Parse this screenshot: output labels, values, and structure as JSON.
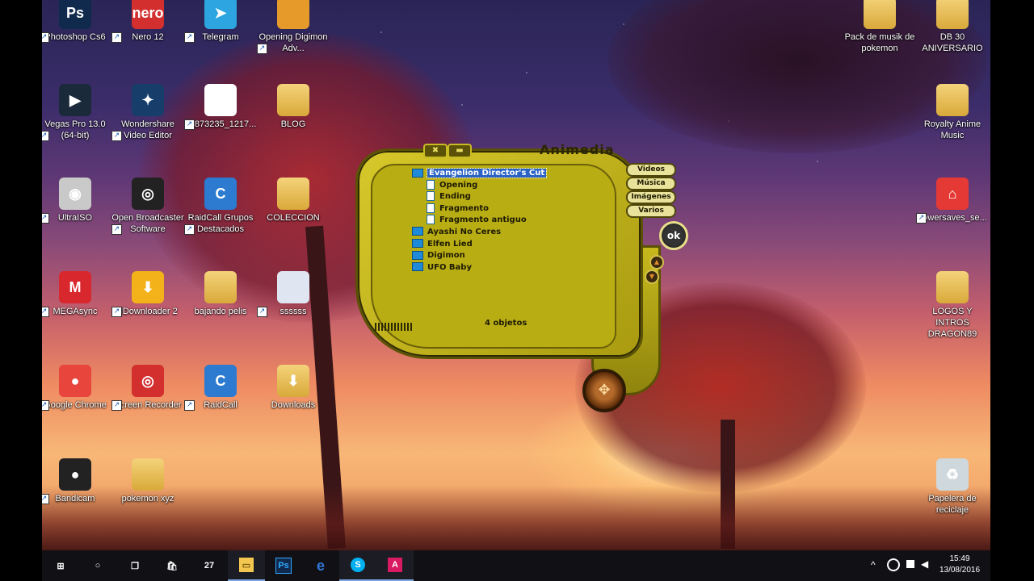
{
  "desktop": {
    "icons_left": [
      {
        "label": "Photoshop Cs6",
        "icon": "photoshop-icon",
        "glyph": "Ps",
        "color": "#0f2a4d"
      },
      {
        "label": "Nero 12",
        "icon": "nero-icon",
        "glyph": "nero",
        "color": "#d32f2f"
      },
      {
        "label": "Telegram",
        "icon": "telegram-icon",
        "glyph": "➤",
        "color": "#2ca5e0"
      },
      {
        "label": "Opening Digimon Adv...",
        "icon": "video-thumbnail-icon",
        "glyph": "",
        "color": "#e59a2a"
      },
      {
        "label": "Vegas Pro 13.0 (64-bit)",
        "icon": "vegas-icon",
        "glyph": "▶",
        "color": "#1a2a3a"
      },
      {
        "label": "Wondershare Video Editor",
        "icon": "wondershare-icon",
        "glyph": "✦",
        "color": "#173e6b"
      },
      {
        "label": "13873235_1217...",
        "icon": "image-file-icon",
        "glyph": "",
        "color": "#ffffff"
      },
      {
        "label": "BLOG",
        "icon": "folder-icon",
        "glyph": "",
        "color": "#e1b84c"
      },
      {
        "label": "UltraISO",
        "icon": "ultraiso-icon",
        "glyph": "◉",
        "color": "#c9c9c9"
      },
      {
        "label": "Open Broadcaster Software",
        "icon": "obs-icon",
        "glyph": "◎",
        "color": "#222"
      },
      {
        "label": "RaidCall Grupos Destacados",
        "icon": "raidcall-icon",
        "glyph": "C",
        "color": "#2c7bd1"
      },
      {
        "label": "COLECCION",
        "icon": "folder-icon",
        "glyph": "",
        "color": "#e1b84c"
      },
      {
        "label": "MEGAsync",
        "icon": "mega-icon",
        "glyph": "M",
        "color": "#d9272e"
      },
      {
        "label": "JDownloader 2",
        "icon": "jdownloader-icon",
        "glyph": "⬇",
        "color": "#f3b21a"
      },
      {
        "label": "bajando pelis",
        "icon": "folder-icon",
        "glyph": "",
        "color": "#e1b84c"
      },
      {
        "label": "ssssss",
        "icon": "document-icon",
        "glyph": "",
        "color": "#dfe6f2"
      },
      {
        "label": "Google Chrome",
        "icon": "chrome-icon",
        "glyph": "●",
        "color": "#e8453c"
      },
      {
        "label": "Screen Recorder",
        "icon": "screen-recorder-icon",
        "glyph": "◎",
        "color": "#d32f2f"
      },
      {
        "label": "RaidCall",
        "icon": "raidcall-icon",
        "glyph": "C",
        "color": "#2c7bd1"
      },
      {
        "label": "Downloads",
        "icon": "downloads-folder-icon",
        "glyph": "⬇",
        "color": "#e1b84c"
      },
      {
        "label": "Bandicam",
        "icon": "bandicam-icon",
        "glyph": "●",
        "color": "#222"
      },
      {
        "label": "pokemon xyz",
        "icon": "folder-icon",
        "glyph": "",
        "color": "#e1b84c"
      }
    ],
    "icons_right": [
      {
        "label": "Pack de musik de pokemon",
        "icon": "folder-icon",
        "glyph": "",
        "color": "#e1b84c"
      },
      {
        "label": "DB 30 ANIVERSARIO",
        "icon": "folder-icon",
        "glyph": "",
        "color": "#e1b84c"
      },
      {
        "label": "Royalty Anime Music",
        "icon": "folder-icon",
        "glyph": "",
        "color": "#e1b84c"
      },
      {
        "label": "powersaves_se...",
        "icon": "powersaves-icon",
        "glyph": "⌂",
        "color": "#e53935"
      },
      {
        "label": "LOGOS Y INTROS DRAGON89",
        "icon": "folder-icon",
        "glyph": "",
        "color": "#e1b84c"
      },
      {
        "label": "Papelera de reciclaje",
        "icon": "recycle-bin-icon",
        "glyph": "♻",
        "color": "#cfd8dc"
      }
    ]
  },
  "player": {
    "title": "Animedia",
    "close_glyph": "✖",
    "minimize_glyph": "▬",
    "categories": [
      "Videos",
      "Música",
      "Imágenes",
      "Varios"
    ],
    "ok_label": "ok",
    "tree": [
      {
        "label": "Evangelion Director's Cut",
        "selected": true,
        "children": [
          "Opening",
          "Ending",
          "Fragmento",
          "Fragmento antiguo"
        ]
      },
      {
        "label": "Ayashi No Ceres"
      },
      {
        "label": "Elfen Lied"
      },
      {
        "label": "Digimon"
      },
      {
        "label": "UFO Baby"
      }
    ],
    "status": "4 objetos",
    "accent": "#c7b91d"
  },
  "taskbar": {
    "items": [
      {
        "name": "start-button",
        "glyph": "⊞"
      },
      {
        "name": "cortana-button",
        "glyph": "○"
      },
      {
        "name": "task-view-button",
        "glyph": "❐"
      },
      {
        "name": "store-app",
        "glyph": "🛍"
      },
      {
        "name": "calendar-app",
        "glyph": "27"
      },
      {
        "name": "file-explorer-app",
        "glyph": "▭"
      },
      {
        "name": "photoshop-app",
        "glyph": "Ps"
      },
      {
        "name": "edge-app",
        "glyph": "e"
      },
      {
        "name": "skype-app",
        "glyph": "S"
      },
      {
        "name": "animedia-app",
        "glyph": "A"
      }
    ],
    "tray": {
      "time": "15:49",
      "date": "13/08/2016"
    }
  }
}
